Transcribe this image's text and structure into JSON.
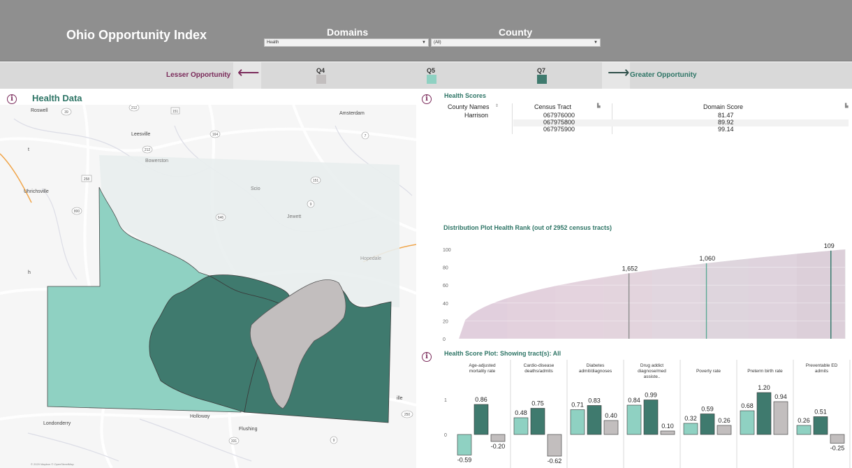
{
  "header": {
    "title": "Ohio Opportunity Index",
    "domains_label": "Domains",
    "county_label": "County",
    "domain_value": "Health",
    "county_value": "(All)"
  },
  "legend": {
    "lesser": "Lesser Opportunity",
    "greater": "Greater Opportunity",
    "quintiles": [
      {
        "label": "Q4",
        "color": "#c2bebe"
      },
      {
        "label": "Q5",
        "color": "#8fd1c2"
      },
      {
        "label": "Q7",
        "color": "#3f7a6e"
      }
    ]
  },
  "map_panel": {
    "title": "Health Data",
    "place_labels": [
      "Roswell",
      "Amsterdam",
      "Leesville",
      "Bowerston",
      "Scio",
      "Jewett",
      "Hopedale",
      "Holloway",
      "Flushing",
      "Londonderry",
      "Uhrichsville",
      "ille",
      "h",
      "t"
    ],
    "route_labels": [
      "39",
      "212",
      "151",
      "258",
      "800",
      "212",
      "646",
      "164",
      "9",
      "151",
      "7",
      "250",
      "331",
      "9"
    ],
    "attribution": "© 2020 Mapbox © OpenStreetMap"
  },
  "scores": {
    "title": "Health Scores",
    "columns": [
      "County Names",
      "Census Tract",
      "Domain Score"
    ],
    "county": "Harrison",
    "rows": [
      {
        "tract": "067976000",
        "score": "81.47"
      },
      {
        "tract": "067975800",
        "score": "89.92"
      },
      {
        "tract": "067975900",
        "score": "99.14"
      }
    ]
  },
  "distribution": {
    "title": "Distribution Plot Health Rank (out of 2952 census tracts)",
    "y_ticks": [
      "100",
      "80",
      "60",
      "40",
      "20",
      "0"
    ],
    "markers": [
      "1,652",
      "1,060",
      "109"
    ]
  },
  "score_plot": {
    "title": "Health Score Plot: Showing tract(s): All",
    "y_ticks": [
      "1",
      "0"
    ],
    "columns": [
      {
        "title": "Age-adjusted mortality rate",
        "values": [
          "-0.59",
          "0.86",
          "-0.20"
        ]
      },
      {
        "title": "Cardio-disease deaths/admits",
        "values": [
          "0.48",
          "0.75",
          "-0.62"
        ]
      },
      {
        "title": "Diabetes admit/diagnoses",
        "values": [
          "0.71",
          "0.83",
          "0.40"
        ]
      },
      {
        "title": "Drug addict diagnose/med assiste..",
        "values": [
          "0.84",
          "0.99",
          "0.10"
        ]
      },
      {
        "title": "Poverty rate",
        "values": [
          "0.32",
          "0.59",
          "0.26"
        ]
      },
      {
        "title": "Preterm birth rate",
        "values": [
          "0.68",
          "1.20",
          "0.94"
        ]
      },
      {
        "title": "Preventable ED admits",
        "values": [
          "0.26",
          "0.51",
          "-0.25"
        ]
      }
    ]
  },
  "chart_data": [
    {
      "type": "area",
      "title": "Distribution Plot Health Rank (out of 2952 census tracts)",
      "ylim": [
        0,
        100
      ],
      "markers": [
        {
          "label": "1,652",
          "rank": 1652
        },
        {
          "label": "1,060",
          "rank": 1060
        },
        {
          "label": "109",
          "rank": 109
        }
      ]
    },
    {
      "type": "bar",
      "title": "Health Score Plot: Showing tract(s): All",
      "categories": [
        "Age-adjusted mortality rate",
        "Cardio-disease deaths/admits",
        "Diabetes admit/diagnoses",
        "Drug addict diagnose/med assiste..",
        "Poverty rate",
        "Preterm birth rate",
        "Preventable ED admits"
      ],
      "series": [
        {
          "color": "#8fd1c2",
          "values": [
            -0.59,
            0.48,
            0.71,
            0.84,
            0.32,
            0.68,
            0.26
          ]
        },
        {
          "color": "#3f7a6e",
          "values": [
            0.86,
            0.75,
            0.83,
            0.99,
            0.59,
            1.2,
            0.51
          ]
        },
        {
          "color": "#c2bebe",
          "values": [
            -0.2,
            -0.62,
            0.4,
            0.1,
            0.26,
            0.94,
            -0.25
          ]
        }
      ]
    }
  ]
}
